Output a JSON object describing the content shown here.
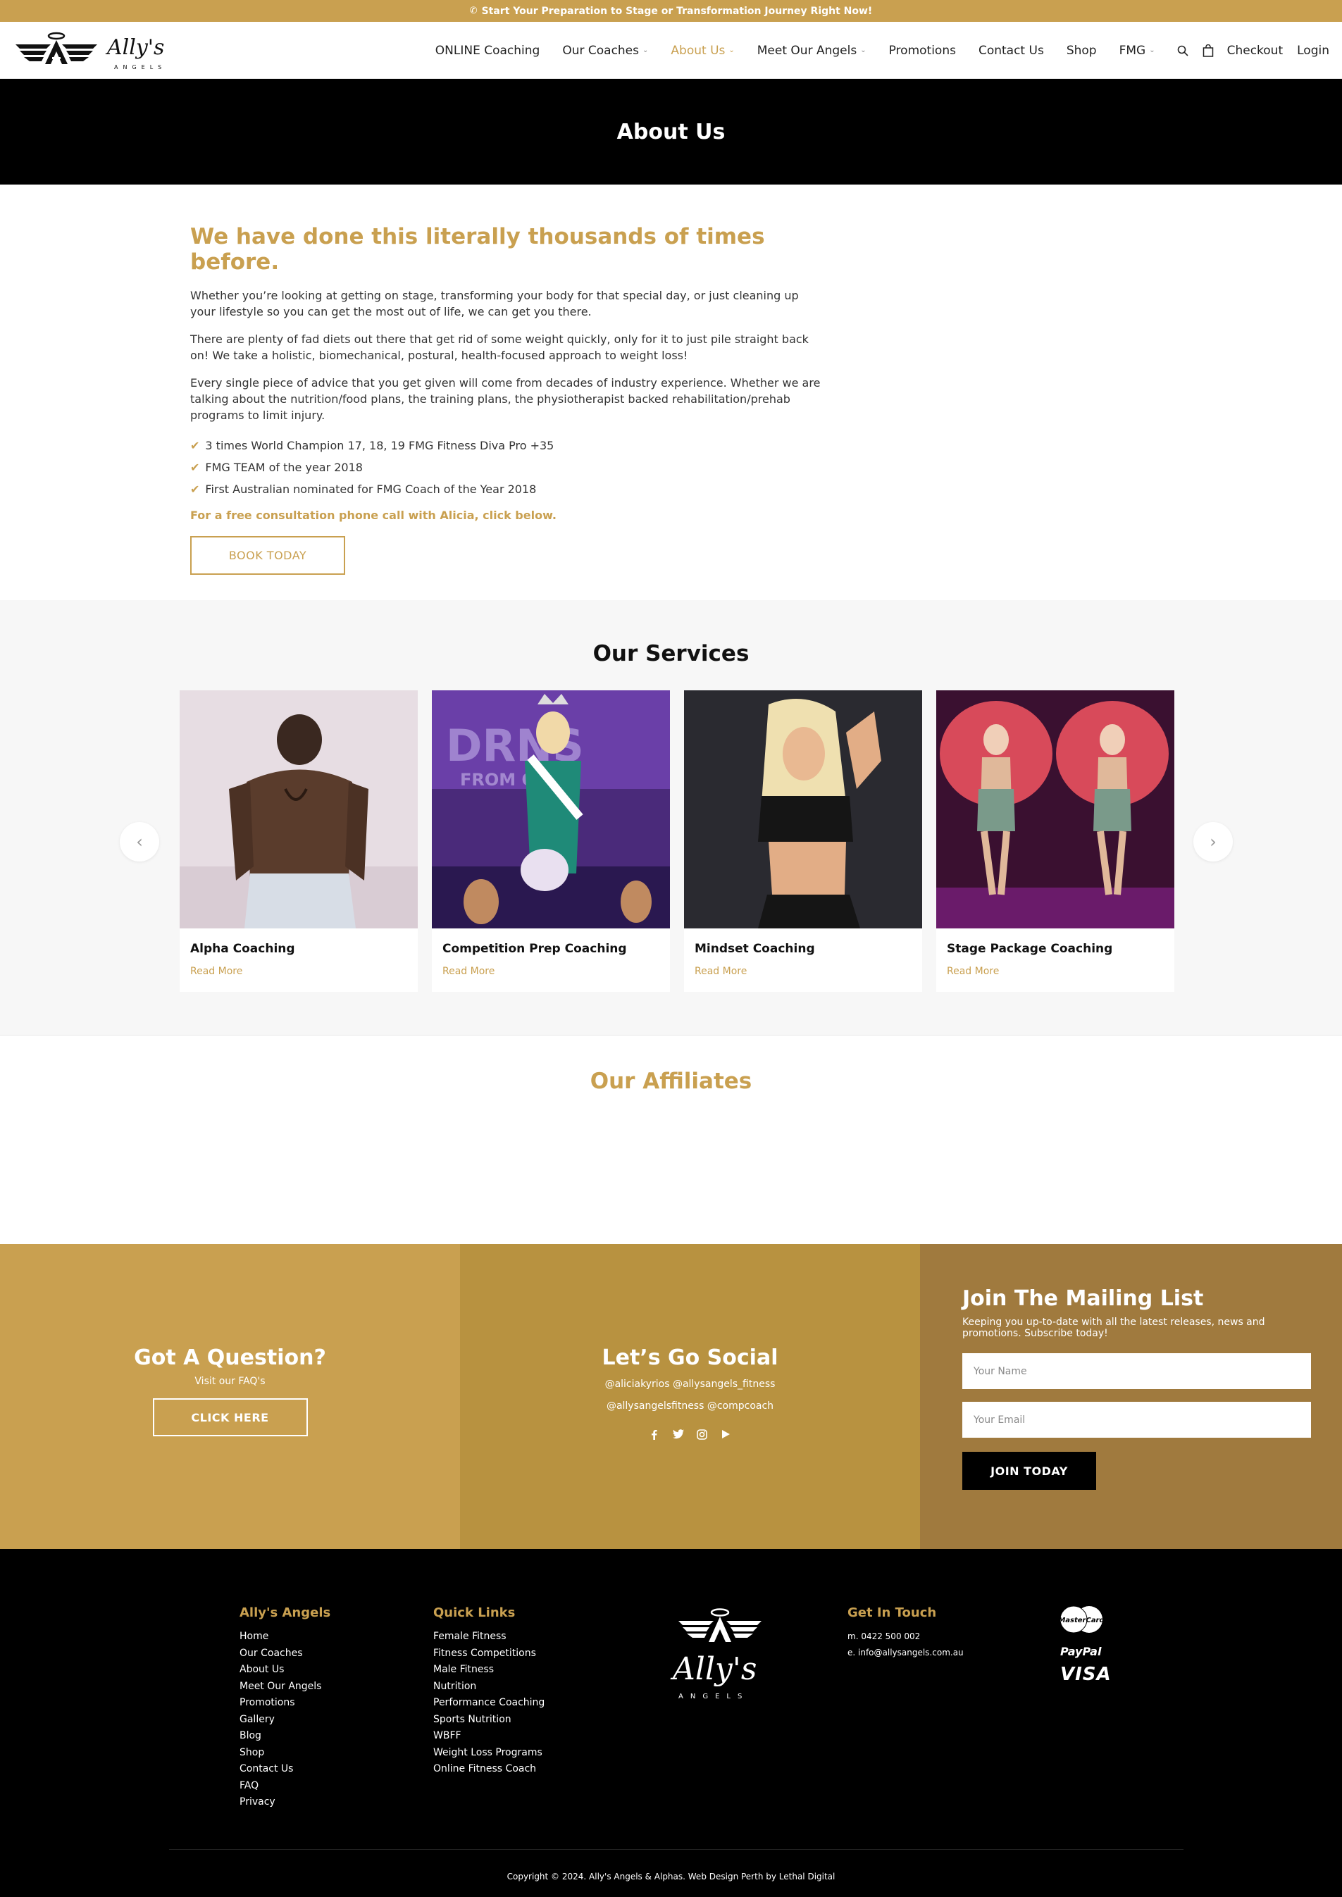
{
  "topbar": {
    "icon": "phone-icon",
    "text": "Start Your Preparation to Stage or Transformation Journey Right Now!"
  },
  "header": {
    "logo_alt": "Ally's Angels",
    "nav": [
      {
        "label": "ONLINE Coaching",
        "dropdown": false,
        "active": false
      },
      {
        "label": "Our Coaches",
        "dropdown": true,
        "active": false
      },
      {
        "label": "About Us",
        "dropdown": true,
        "active": true
      },
      {
        "label": "Meet Our Angels",
        "dropdown": true,
        "active": false
      },
      {
        "label": "Promotions",
        "dropdown": false,
        "active": false
      },
      {
        "label": "Contact Us",
        "dropdown": false,
        "active": false
      },
      {
        "label": "Shop",
        "dropdown": false,
        "active": false
      },
      {
        "label": "FMG",
        "dropdown": true,
        "active": false
      }
    ],
    "checkout_label": "Checkout",
    "login_label": "Login"
  },
  "hero": {
    "title": "About Us"
  },
  "about": {
    "heading": "We have done this literally thousands of times before.",
    "paragraphs": [
      "Whether you’re looking at getting on stage, transforming your body for that special day, or just cleaning up your lifestyle so you can get the most out of life, we can get you there.",
      "There are plenty of fad diets out there that get rid of some weight quickly, only for it to just pile straight back on! We take a holistic, biomechanical, postural, health-focused approach to weight loss!",
      "Every single piece of advice that you get given will come from decades of industry experience. Whether we are talking about the nutrition/food plans, the training plans, the physiotherapist backed rehabilitation/prehab programs to limit injury."
    ],
    "checklist": [
      "3 times World Champion 17, 18, 19 FMG Fitness Diva Pro +35",
      "FMG TEAM of the year 2018",
      "First Australian nominated for FMG Coach of the Year 2018"
    ],
    "consult_text": "For a free consultation phone call with Alicia, click below.",
    "book_label": "BOOK TODAY"
  },
  "services": {
    "title": "Our Services",
    "cards": [
      {
        "title": "Alpha Coaching",
        "more": "Read More"
      },
      {
        "title": "Competition Prep Coaching",
        "more": "Read More"
      },
      {
        "title": "Mindset Coaching",
        "more": "Read More"
      },
      {
        "title": "Stage Package Coaching",
        "more": "Read More"
      }
    ]
  },
  "affiliates": {
    "title": "Our Affiliates"
  },
  "cta": {
    "question": {
      "title": "Got A Question?",
      "sub": "Visit our FAQ's",
      "button": "CLICK HERE"
    },
    "social": {
      "title": "Let’s Go Social",
      "line1": "@aliciakyrios @allysangels_fitness",
      "line2": "@allysangelsfitness @compcoach",
      "icons": [
        "facebook-icon",
        "twitter-icon",
        "instagram-icon",
        "youtube-icon"
      ]
    },
    "mailing": {
      "title": "Join The Mailing List",
      "desc": "Keeping you up-to-date with all the latest releases, news and promotions. Subscribe today!",
      "name_placeholder": "Your Name",
      "email_placeholder": "Your Email",
      "button": "JOIN TODAY"
    }
  },
  "footer": {
    "col1": {
      "title": "Ally's Angels",
      "links": [
        "Home",
        "Our Coaches",
        "About Us",
        "Meet Our Angels",
        "Promotions",
        "Gallery",
        "Blog",
        "Shop",
        "Contact Us",
        "FAQ",
        "Privacy"
      ]
    },
    "col2": {
      "title": "Quick Links",
      "links": [
        "Female Fitness",
        "Fitness Competitions",
        "Male Fitness",
        "Nutrition",
        "Performance Coaching",
        "Sports Nutrition",
        "WBFF",
        "Weight Loss Programs",
        "Online Fitness Coach"
      ]
    },
    "touch": {
      "title": "Get In Touch",
      "phone": "m. 0422 500 002",
      "email": "e. info@allysangels.com.au"
    },
    "payments": {
      "mastercard": "MasterCard",
      "paypal": "PayPal",
      "visa": "VISA"
    },
    "copyright": "Copyright © 2024. Ally's Angels & Alphas. Web Design Perth by Lethal Digital"
  },
  "colors": {
    "gold": "#c9a050",
    "gold_mid": "#b89240",
    "gold_dark": "#a07a3e",
    "black": "#000000"
  }
}
